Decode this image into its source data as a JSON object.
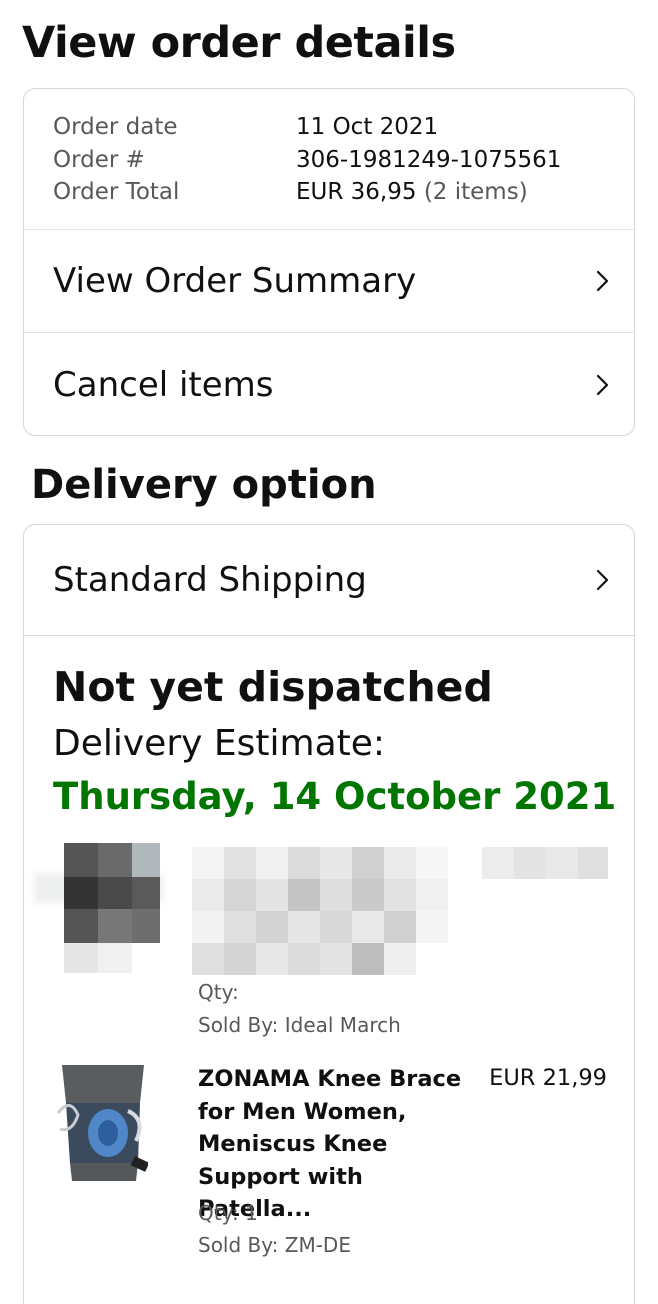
{
  "page_title": "View order details",
  "order_info": {
    "date_label": "Order date",
    "date_value": "11 Oct 2021",
    "number_label": "Order #",
    "number_value": "306-1981249-1075561",
    "total_label": "Order Total",
    "total_value": "EUR 36,95",
    "total_items": "(2 items)"
  },
  "actions": {
    "view_summary": "View Order Summary",
    "cancel_items": "Cancel items"
  },
  "delivery": {
    "section_title": "Delivery option",
    "shipping_method": "Standard Shipping",
    "status": "Not yet dispatched",
    "estimate_label": "Delivery Estimate:",
    "estimate_date": "Thursday, 14 October 2021",
    "estimate_color": "#007600"
  },
  "items": [
    {
      "qty": "Qty:",
      "sold_by": "Sold By: Ideal March",
      "obscured": true
    },
    {
      "title": "ZONAMA Knee Brace for Men Women, Meniscus Knee Support with Patella...",
      "price": "EUR 21,99",
      "qty": "Qty: 1",
      "sold_by": "Sold By: ZM-DE",
      "image_icon": "knee-brace-product-image"
    }
  ],
  "icons": {
    "chevron": "chevron-right-icon"
  }
}
